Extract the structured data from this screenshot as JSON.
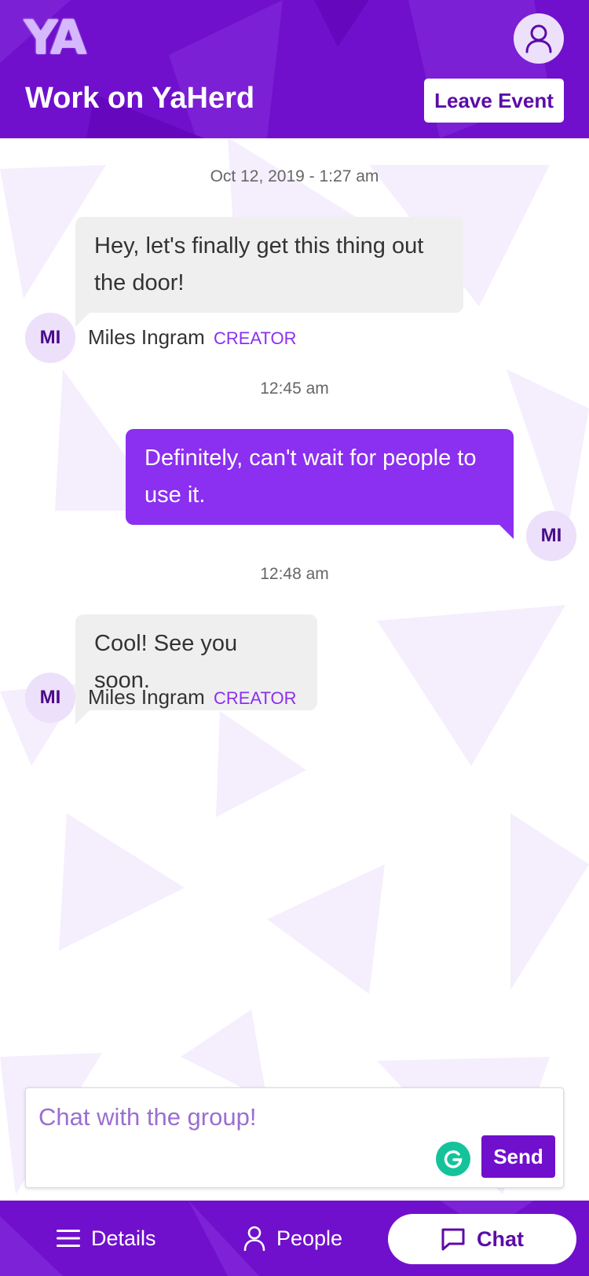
{
  "header": {
    "logo_text": "YA",
    "title": "Work on YaHerd",
    "leave_button": "Leave Event",
    "profile_icon": "user-icon"
  },
  "messages": [
    {
      "timestamp": "Oct 12, 2019 - 1:27 am",
      "direction": "incoming",
      "text": "Hey, let's finally get this thing out the door!",
      "avatar_initials": "MI",
      "author": "Miles Ingram",
      "role": "CREATOR"
    },
    {
      "timestamp": "12:45 am",
      "direction": "outgoing",
      "text": "Definitely, can't wait for people to use it.",
      "avatar_initials": "MI"
    },
    {
      "timestamp": "12:48 am",
      "direction": "incoming",
      "text": "Cool! See you soon.",
      "avatar_initials": "MI",
      "author": "Miles Ingram",
      "role": "CREATOR"
    }
  ],
  "composer": {
    "placeholder": "Chat with the group!",
    "send_label": "Send",
    "grammarly_icon": "grammarly-icon"
  },
  "nav": {
    "items": [
      {
        "label": "Details",
        "icon": "menu-icon",
        "active": false
      },
      {
        "label": "People",
        "icon": "user-icon",
        "active": false
      },
      {
        "label": "Chat",
        "icon": "chat-icon",
        "active": true
      }
    ]
  },
  "colors": {
    "brand": "#7010cc",
    "outgoing_bubble": "#8b2ff0",
    "incoming_bubble": "#efefef",
    "avatar_bg": "#ece0fb",
    "grammarly": "#15c39a"
  }
}
